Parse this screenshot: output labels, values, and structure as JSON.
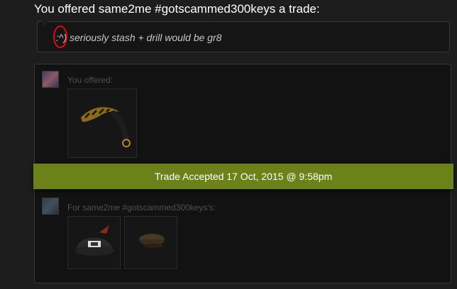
{
  "header": {
    "title": "You offered same2me #gotscammed300keys a trade:"
  },
  "message": {
    "text": ":^) seriously stash + drill would be gr8"
  },
  "trade": {
    "offered_label": "You offered:",
    "received_label": "For same2me #gotscammed300keys's:",
    "status": "Trade Accepted 17 Oct, 2015 @ 9:58pm",
    "status_color": "#6b8219"
  },
  "items": {
    "offered": [
      {
        "icon": "knife-item-icon"
      }
    ],
    "received": [
      {
        "icon": "helmet-item-icon"
      },
      {
        "icon": "cap-item-icon"
      }
    ]
  }
}
